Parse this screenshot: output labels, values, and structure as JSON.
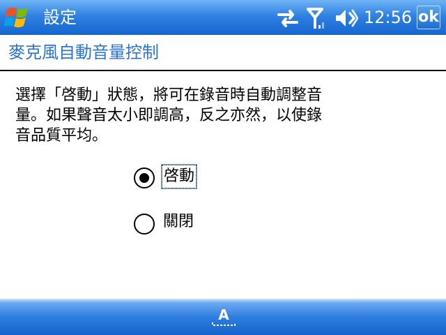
{
  "titlebar": {
    "title": "設定",
    "clock": "12:56",
    "ok_label": "ok"
  },
  "page": {
    "title": "麥克風自動音量控制",
    "description": "選擇「啓動」狀態，將可在錄音時自動調整音量。如果聲音太小即調高，反之亦然，以使錄音品質平均。"
  },
  "options": [
    {
      "label": "啓動",
      "selected": true
    },
    {
      "label": "關閉",
      "selected": false
    }
  ],
  "bottombar": {
    "sip_label": "A"
  },
  "colors": {
    "titlebar": "#2f82e2",
    "page_title": "#2b74d1",
    "bottombar": "#1f72d8"
  }
}
